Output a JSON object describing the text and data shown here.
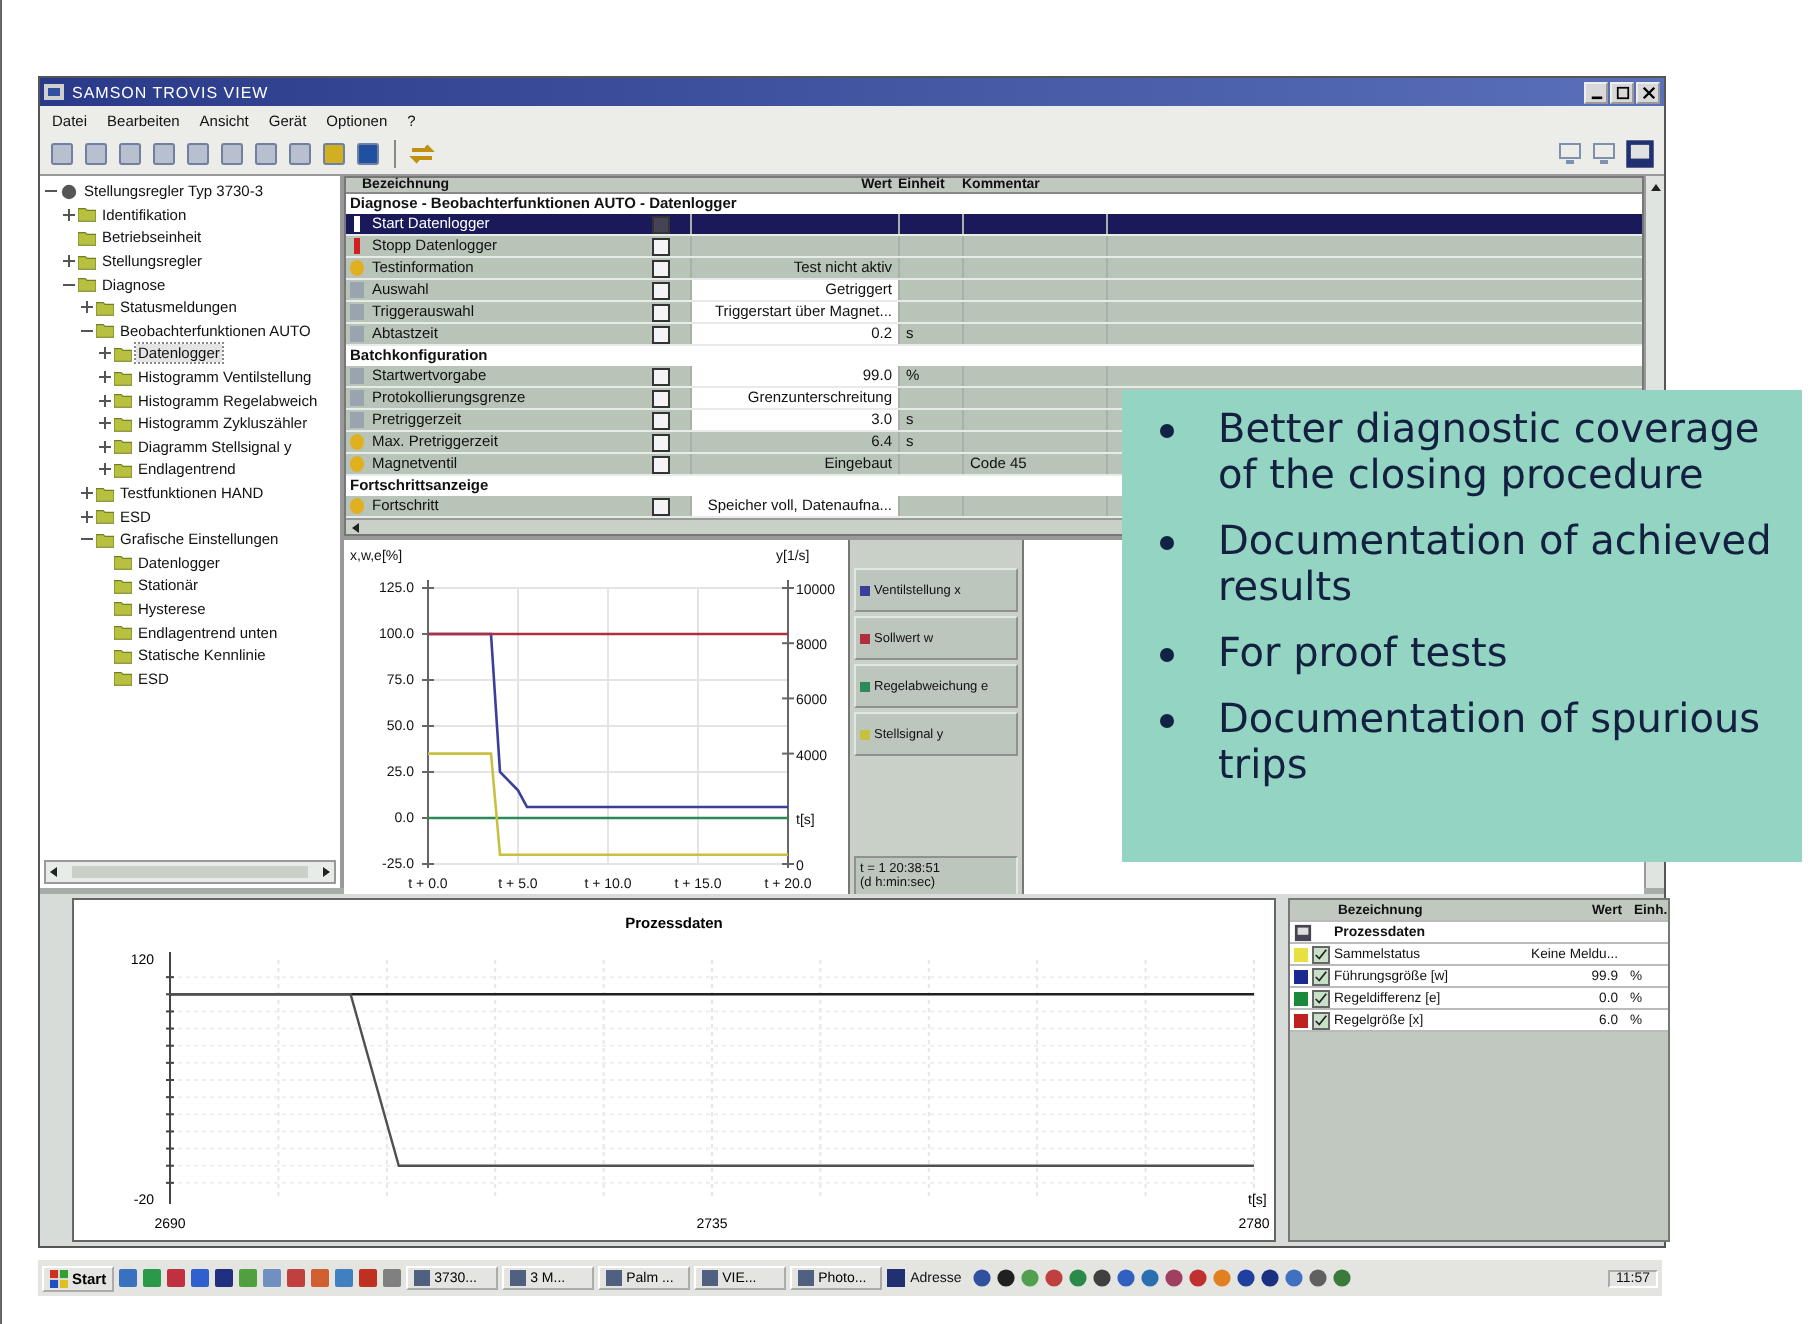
{
  "window": {
    "title": "SAMSON TROVIS VIEW"
  },
  "menu": [
    "Datei",
    "Bearbeiten",
    "Ansicht",
    "Gerät",
    "Optionen",
    "?"
  ],
  "tree": {
    "label": "Stellungsregler Typ 3730-3",
    "expanded": true,
    "selected": false,
    "children": [
      {
        "label": "Identifikation",
        "expanded": false,
        "selected": false
      },
      {
        "label": "Betriebseinheit",
        "selected": false
      },
      {
        "label": "Stellungsregler",
        "expanded": false,
        "selected": false
      },
      {
        "label": "Diagnose",
        "expanded": true,
        "selected": false,
        "children": [
          {
            "label": "Statusmeldungen",
            "expanded": false,
            "selected": false
          },
          {
            "label": "Beobachterfunktionen AUTO",
            "expanded": true,
            "selected": false,
            "children": [
              {
                "label": "Datenlogger",
                "selected": true,
                "expanded": false
              },
              {
                "label": "Histogramm Ventilstellung",
                "selected": false,
                "expanded": false
              },
              {
                "label": "Histogramm Regelabweich",
                "selected": false,
                "expanded": false
              },
              {
                "label": "Histogramm Zykluszähler",
                "selected": false,
                "expanded": false
              },
              {
                "label": "Diagramm Stellsignal y",
                "selected": false,
                "expanded": false
              },
              {
                "label": "Endlagentrend",
                "selected": false,
                "expanded": false
              }
            ]
          },
          {
            "label": "Testfunktionen HAND",
            "expanded": false,
            "selected": false
          },
          {
            "label": "ESD",
            "expanded": false,
            "selected": false
          },
          {
            "label": "Grafische Einstellungen",
            "expanded": true,
            "selected": false,
            "children": [
              {
                "label": "Datenlogger",
                "selected": false
              },
              {
                "label": "Stationär",
                "selected": false
              },
              {
                "label": "Hysterese",
                "selected": false
              },
              {
                "label": "Endlagentrend unten",
                "selected": false
              },
              {
                "label": "Statische Kennlinie",
                "selected": false
              },
              {
                "label": "ESD",
                "selected": false
              }
            ]
          }
        ]
      }
    ]
  },
  "table": {
    "columns": [
      "Bezeichnung",
      "Wert",
      "Einheit",
      "Kommentar"
    ],
    "sections": [
      {
        "title": "Diagnose - Beobachterfunktionen AUTO - Datenlogger",
        "rows": [
          {
            "name": "Start Datenlogger",
            "kind": "action",
            "selected": true,
            "editable": false
          },
          {
            "name": "Stopp Datenlogger",
            "kind": "stop",
            "selected": false,
            "editable": false
          },
          {
            "name": "Testinformation",
            "kind": "info",
            "selected": false,
            "editable": false,
            "value": "Test nicht aktiv"
          },
          {
            "name": "Auswahl",
            "kind": "param",
            "selected": false,
            "editable": true,
            "value": "Getriggert"
          },
          {
            "name": "Triggerauswahl",
            "kind": "param",
            "selected": false,
            "editable": true,
            "value": "Triggerstart über Magnet..."
          },
          {
            "name": "Abtastzeit",
            "kind": "param",
            "selected": false,
            "editable": true,
            "value": "0.2",
            "unit": "s"
          }
        ]
      },
      {
        "title": "Batchkonfiguration",
        "rows": [
          {
            "name": "Startwertvorgabe",
            "kind": "param",
            "selected": false,
            "editable": true,
            "value": "99.0",
            "unit": "%"
          },
          {
            "name": "Protokollierungsgrenze",
            "kind": "param",
            "selected": false,
            "editable": true,
            "value": "Grenzunterschreitung"
          },
          {
            "name": "Pretriggerzeit",
            "kind": "param",
            "selected": false,
            "editable": true,
            "value": "3.0",
            "unit": "s"
          },
          {
            "name": "Max. Pretriggerzeit",
            "kind": "info",
            "selected": false,
            "editable": false,
            "value": "6.4",
            "unit": "s"
          },
          {
            "name": "Magnetventil",
            "kind": "info",
            "selected": false,
            "editable": false,
            "value": "Eingebaut",
            "comment": "Code 45"
          }
        ]
      },
      {
        "title": "Fortschrittsanzeige",
        "rows": [
          {
            "name": "Fortschritt",
            "kind": "info",
            "selected": false,
            "editable": true,
            "value": "Speicher voll, Datenaufna..."
          }
        ]
      }
    ]
  },
  "trend": {
    "chart_data": {
      "type": "line",
      "ylabel": "x,w,e[%]",
      "xlabel": "t[s]",
      "x": [
        0,
        3.5,
        4,
        5,
        5.5,
        10,
        15,
        20
      ],
      "series": [
        {
          "name": "Ventilstellung x",
          "color": "#3a3f9a",
          "values": [
            100,
            100,
            25,
            15,
            6,
            6,
            6,
            6
          ]
        },
        {
          "name": "Sollwert w",
          "color": "#b03040",
          "values": [
            100,
            100,
            100,
            100,
            100,
            100,
            100,
            100
          ]
        },
        {
          "name": "Regelabweichung e",
          "color": "#2a8a5a",
          "values": [
            0,
            0,
            0,
            0,
            0,
            0,
            0,
            0
          ]
        },
        {
          "name": "Stellsignal y",
          "color": "#c8c040",
          "values": [
            35,
            35,
            -20,
            -20,
            -20,
            -20,
            -20,
            -20
          ]
        }
      ],
      "xlim": [
        0,
        20
      ],
      "ylim": [
        -25,
        125
      ],
      "grid": true,
      "xticks": [
        {
          "value": 0,
          "label": "t + 0.0"
        },
        {
          "value": 5,
          "label": "t + 5.0"
        },
        {
          "value": 10,
          "label": "t + 10.0"
        },
        {
          "value": 15,
          "label": "t + 15.0"
        },
        {
          "value": 20,
          "label": "t + 20.0"
        }
      ],
      "yticks": [
        {
          "value": 125,
          "label": "125.0"
        },
        {
          "value": 100,
          "label": "100.0"
        },
        {
          "value": 75,
          "label": "75.0"
        },
        {
          "value": 50,
          "label": "50.0"
        },
        {
          "value": 25,
          "label": "25.0"
        },
        {
          "value": 0,
          "label": "0.0"
        },
        {
          "value": -25,
          "label": "-25.0"
        }
      ],
      "y2label": "y[1/s]",
      "y2lim": [
        0,
        10000
      ],
      "y2ticks": [
        10000,
        8000,
        6000,
        4000,
        0
      ]
    },
    "time": [
      "t = 1 20:38:51",
      "(d h:min:sec)"
    ]
  },
  "process": {
    "chart_data": {
      "type": "line",
      "title": "Prozessdaten",
      "xlabel": "t[s]",
      "x": [
        2690,
        2705,
        2709,
        2780
      ],
      "series": [
        {
          "color": "#202020",
          "values": [
            100,
            100,
            100,
            100
          ]
        },
        {
          "color": "#505050",
          "values": [
            100,
            100,
            0,
            0
          ]
        }
      ],
      "xlim": [
        2690,
        2780
      ],
      "ylim": [
        -20,
        120
      ],
      "grid": true,
      "xticks": [
        2690,
        2735,
        2780
      ],
      "yticks": [
        120,
        -20
      ]
    },
    "columns": [
      "Bezeichnung",
      "Wert",
      "Einh."
    ],
    "group": "Prozessdaten",
    "rows": [
      {
        "name": "Sammelstatus",
        "value": "Keine Meldu...",
        "color": "#e8e040",
        "checked": true
      },
      {
        "name": "Führungsgröße [w]",
        "value": "99.9",
        "unit": "%",
        "color": "#1a2a90",
        "checked": true
      },
      {
        "name": "Regeldifferenz [e]",
        "value": "0.0",
        "unit": "%",
        "color": "#1a8a3a",
        "checked": true
      },
      {
        "name": "Regelgröße [x]",
        "value": "6.0",
        "unit": "%",
        "color": "#c02020",
        "checked": true
      }
    ]
  },
  "taskbar": {
    "start": "Start",
    "tasks": [
      "3730...",
      "3 M...",
      "Palm ...",
      "VIE...",
      "Photo..."
    ],
    "address": "Adresse",
    "clock": "11:57"
  },
  "callout": [
    "Better diagnostic coverage of the closing procedure",
    "Documentation of achieved results",
    "For proof tests",
    "Documentation of spurious trips"
  ]
}
